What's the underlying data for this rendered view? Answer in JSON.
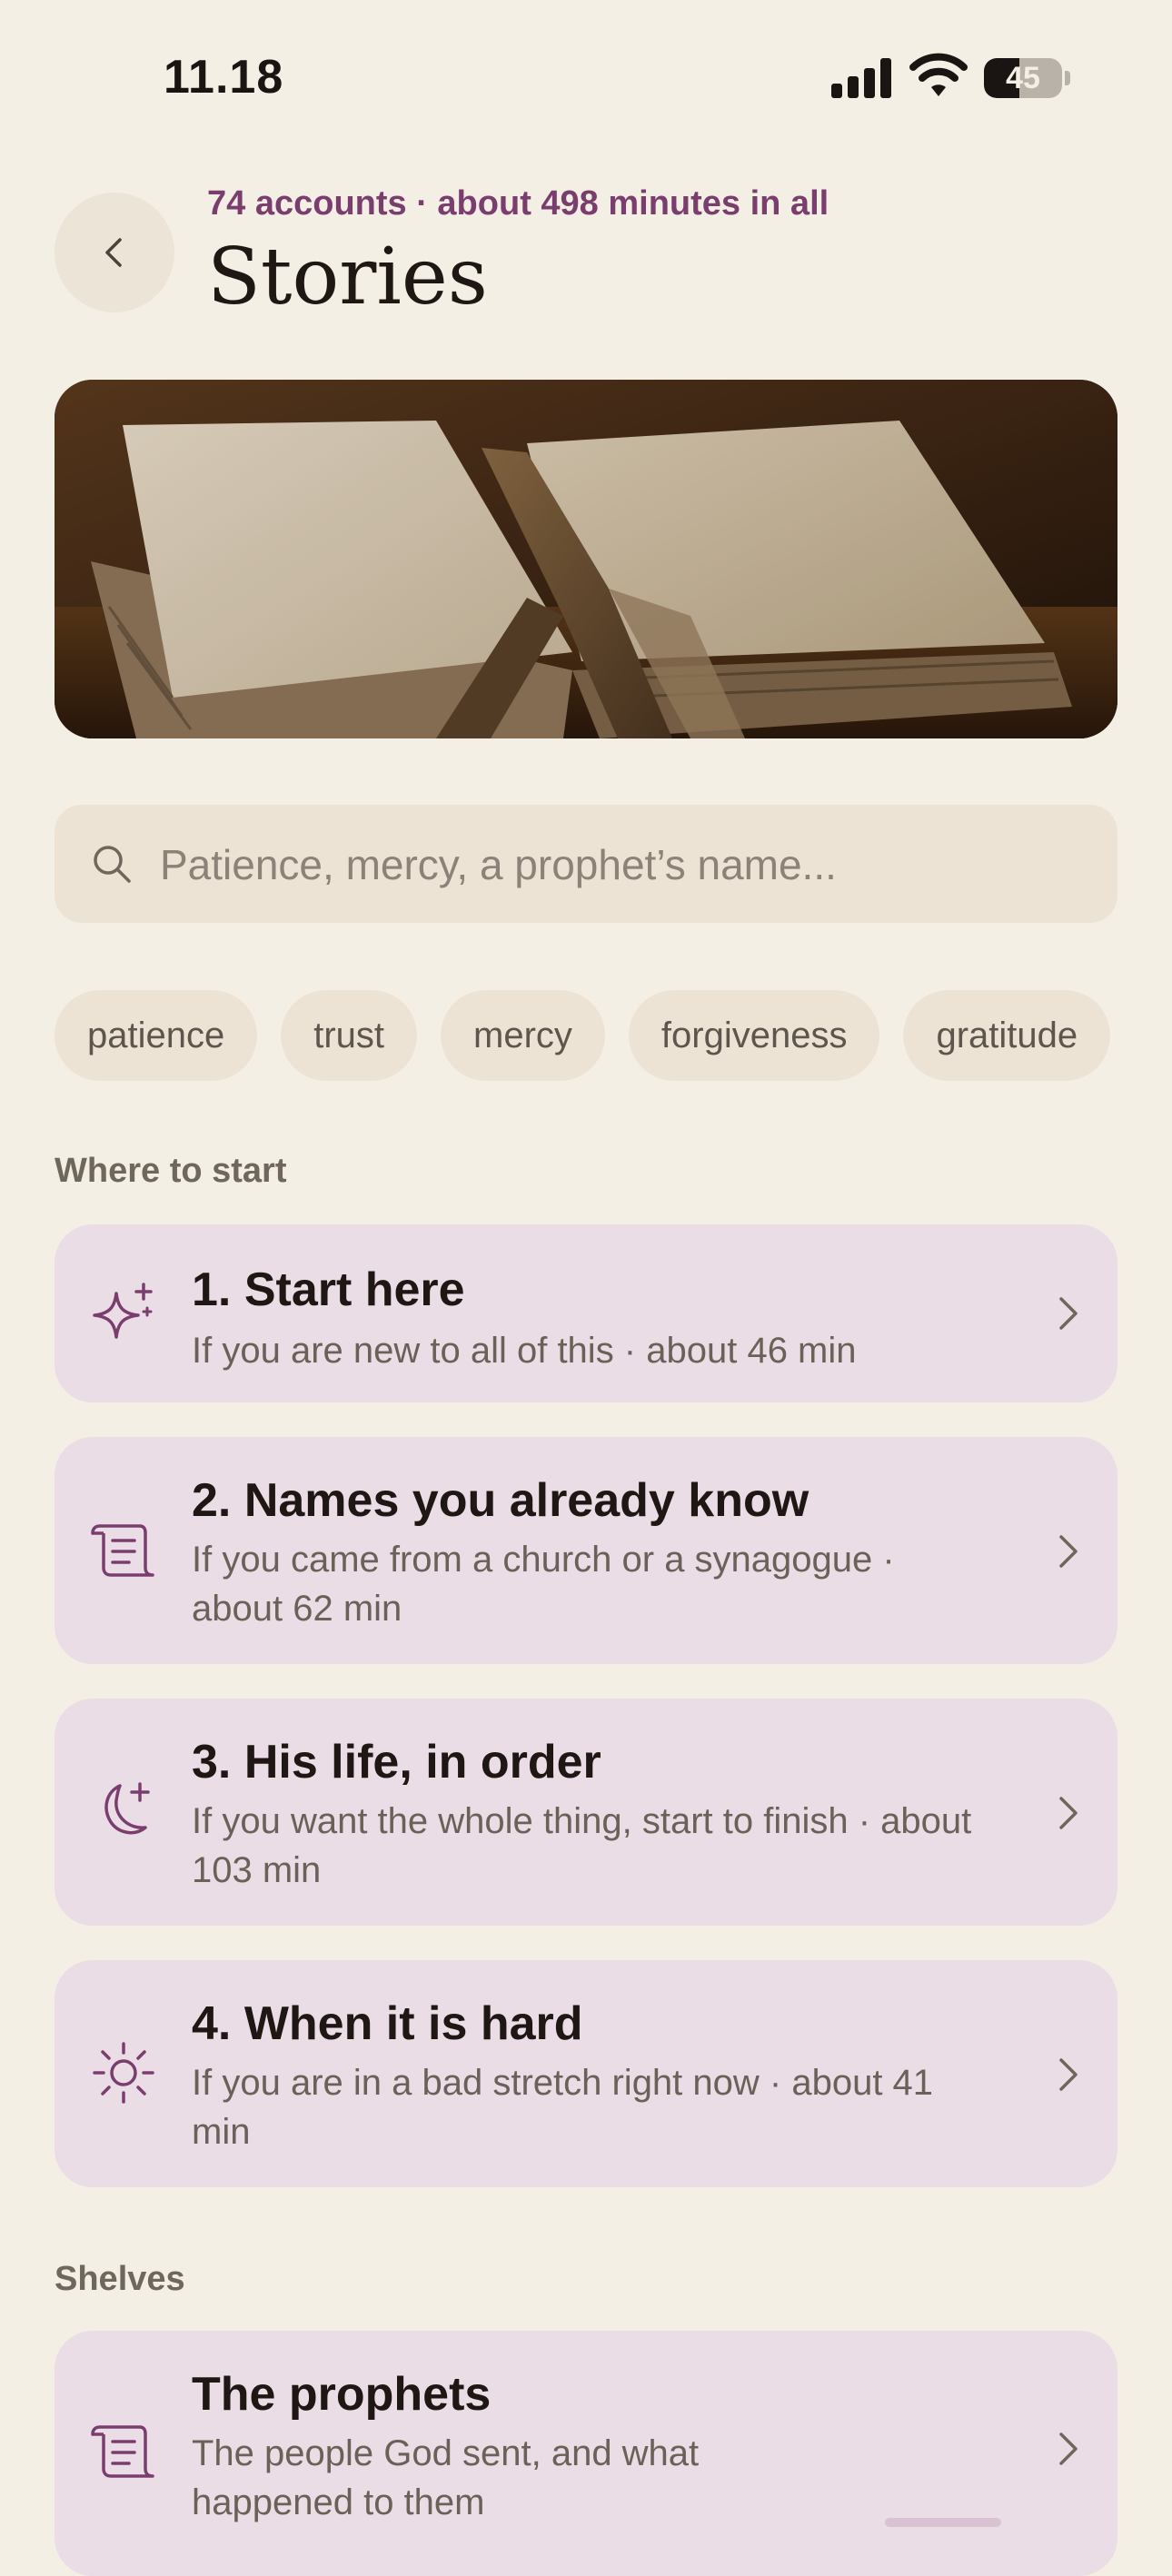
{
  "status_bar": {
    "time": "11.18",
    "battery": "45",
    "battery_level": 0.45
  },
  "header": {
    "subtitle": "74 accounts · about 498 minutes in all",
    "title": "Stories",
    "back_icon": "chevron-left-icon"
  },
  "hero": {
    "image": "open-old-book-with-ribbon"
  },
  "search": {
    "placeholder": "Patience, mercy, a prophet’s name...",
    "value": "",
    "icon": "search-icon"
  },
  "chips": [
    "patience",
    "trust",
    "mercy",
    "forgiveness",
    "gratitude"
  ],
  "sections": {
    "start_label": "Where to start",
    "shelves_label": "Shelves"
  },
  "start_items": [
    {
      "title": "1. Start here",
      "description": "If you are new to all of this · about 46 min",
      "icon": "sparkles-icon"
    },
    {
      "title": "2. Names you already know",
      "description": "If you came from a church or a synagogue · about 62 min",
      "icon": "scroll-icon"
    },
    {
      "title": "3. His life, in order",
      "description": "If you want the whole thing, start to finish · about 103 min",
      "icon": "moon-star-icon"
    },
    {
      "title": "4. When it is hard",
      "description": "If you are in a bad stretch right now · about 41 min",
      "icon": "sun-icon"
    }
  ],
  "shelves": [
    {
      "title": "The prophets",
      "description": "The people God sent, and what happened to them",
      "icon": "scroll-icon"
    }
  ],
  "colors": {
    "background": "#F4EFE4",
    "accent": "#7A3E6E",
    "card": "#EBDDE6",
    "chip": "#ECE3D5"
  }
}
